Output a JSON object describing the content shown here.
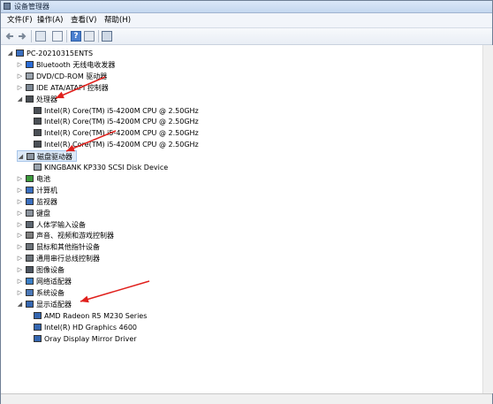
{
  "window": {
    "title": "设备管理器"
  },
  "menu": [
    "文件(F)",
    "操作(A)",
    "查看(V)",
    "帮助(H)"
  ],
  "toolbar": {
    "help_label": "?"
  },
  "tree": {
    "root": "PC-20210315ENTS",
    "categories": [
      {
        "label": "Bluetooth 无线电收发器",
        "icon": "bluetooth-icon",
        "expanded": false
      },
      {
        "label": "DVD/CD-ROM 驱动器",
        "icon": "dvd-drive-icon",
        "expanded": false
      },
      {
        "label": "IDE ATA/ATAPI 控制器",
        "icon": "ide-controller-icon",
        "expanded": false
      },
      {
        "label": "处理器",
        "icon": "processor-icon",
        "expanded": true,
        "children": [
          "Intel(R) Core(TM) i5-4200M CPU @ 2.50GHz",
          "Intel(R) Core(TM) i5-4200M CPU @ 2.50GHz",
          "Intel(R) Core(TM) i5-4200M CPU @ 2.50GHz",
          "Intel(R) Core(TM) i5-4200M CPU @ 2.50GHz"
        ]
      },
      {
        "label": "磁盘驱动器",
        "icon": "disk-drive-icon",
        "expanded": true,
        "selected": true,
        "children": [
          "KINGBANK KP330 SCSI Disk Device"
        ]
      },
      {
        "label": "电池",
        "icon": "battery-icon",
        "expanded": false
      },
      {
        "label": "计算机",
        "icon": "computer-icon",
        "expanded": false
      },
      {
        "label": "监视器",
        "icon": "monitor-icon",
        "expanded": false
      },
      {
        "label": "键盘",
        "icon": "keyboard-icon",
        "expanded": false
      },
      {
        "label": "人体学输入设备",
        "icon": "hid-icon",
        "expanded": false
      },
      {
        "label": "声音、视频和游戏控制器",
        "icon": "sound-icon",
        "expanded": false
      },
      {
        "label": "鼠标和其他指针设备",
        "icon": "mouse-icon",
        "expanded": false
      },
      {
        "label": "通用串行总线控制器",
        "icon": "usb-icon",
        "expanded": false
      },
      {
        "label": "图像设备",
        "icon": "camera-icon",
        "expanded": false
      },
      {
        "label": "网络适配器",
        "icon": "network-icon",
        "expanded": false
      },
      {
        "label": "系统设备",
        "icon": "system-device-icon",
        "expanded": false
      },
      {
        "label": "显示适配器",
        "icon": "display-adapter-icon",
        "expanded": true,
        "children": [
          "AMD Radeon R5 M230 Series",
          "Intel(R) HD Graphics 4600",
          "Oray Display Mirror Driver"
        ]
      }
    ]
  },
  "annotations": {
    "arrow_color": "#e0201c"
  }
}
